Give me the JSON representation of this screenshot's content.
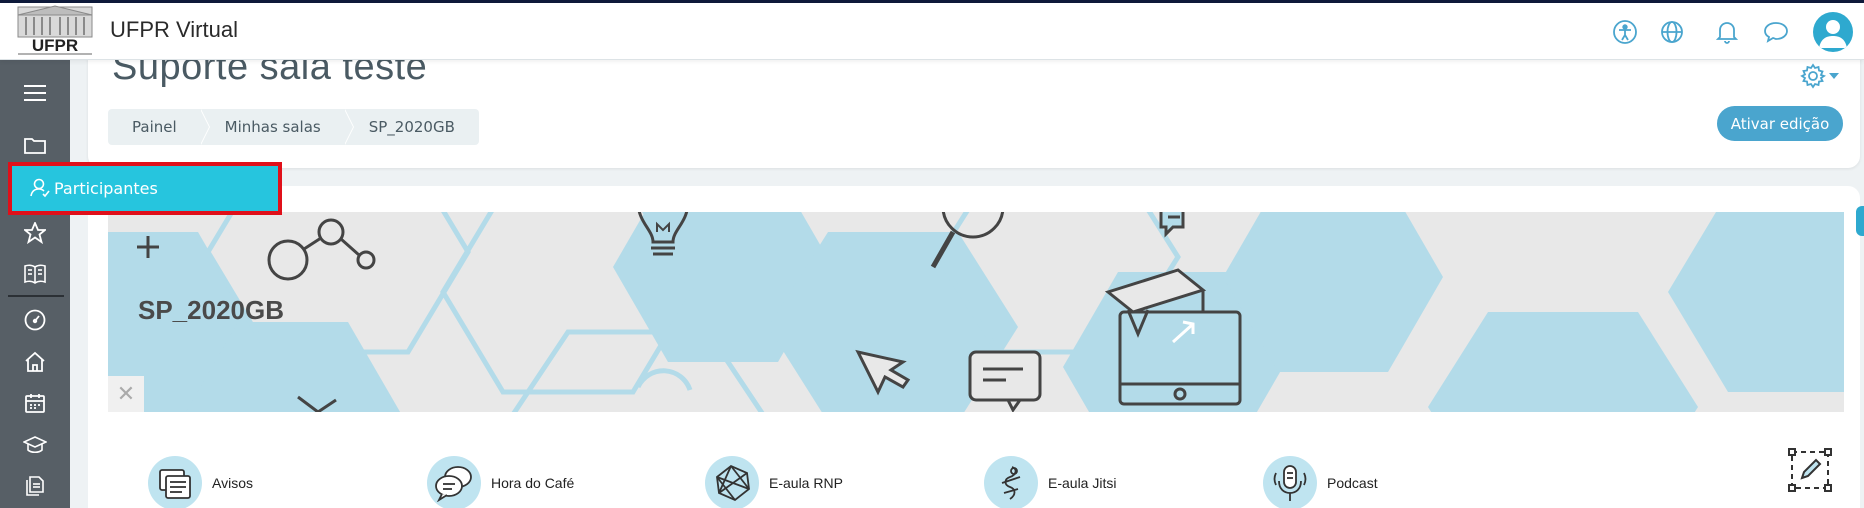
{
  "navbar": {
    "site_title": "UFPR Virtual",
    "logo_text": "UFPR",
    "icons": [
      "accessibility-icon",
      "globe-icon",
      "bell-icon",
      "chat-icon",
      "user-avatar"
    ]
  },
  "sidebar": {
    "items": [
      "menu-icon",
      "folder-icon",
      "participants-icon",
      "star-icon",
      "book-icon",
      "dashboard-icon",
      "home-icon",
      "calendar-icon",
      "graduation-cap-icon",
      "files-icon"
    ]
  },
  "popup": {
    "label": "Participantes"
  },
  "header": {
    "title": "Suporte sala teste",
    "breadcrumb": [
      "Painel",
      "Minhas salas",
      "SP_2020GB"
    ],
    "edit_button": "Ativar edição"
  },
  "banner": {
    "course_code": "SP_2020GB",
    "close_symbol": "✕",
    "plus_symbol": "+"
  },
  "activities": [
    {
      "label": "Avisos",
      "icon": "announcements-icon"
    },
    {
      "label": "Hora do Café",
      "icon": "coffee-chat-icon"
    },
    {
      "label": "E-aula RNP",
      "icon": "network-icon"
    },
    {
      "label": "E-aula Jitsi",
      "icon": "jitsi-icon"
    },
    {
      "label": "Podcast",
      "icon": "microphone-icon"
    }
  ],
  "colors": {
    "accent": "#26c5de",
    "highlight_border": "#e0101a",
    "button": "#4aa5ce",
    "sidebar": "#575f66",
    "hex_blue": "#b3dbe9"
  }
}
